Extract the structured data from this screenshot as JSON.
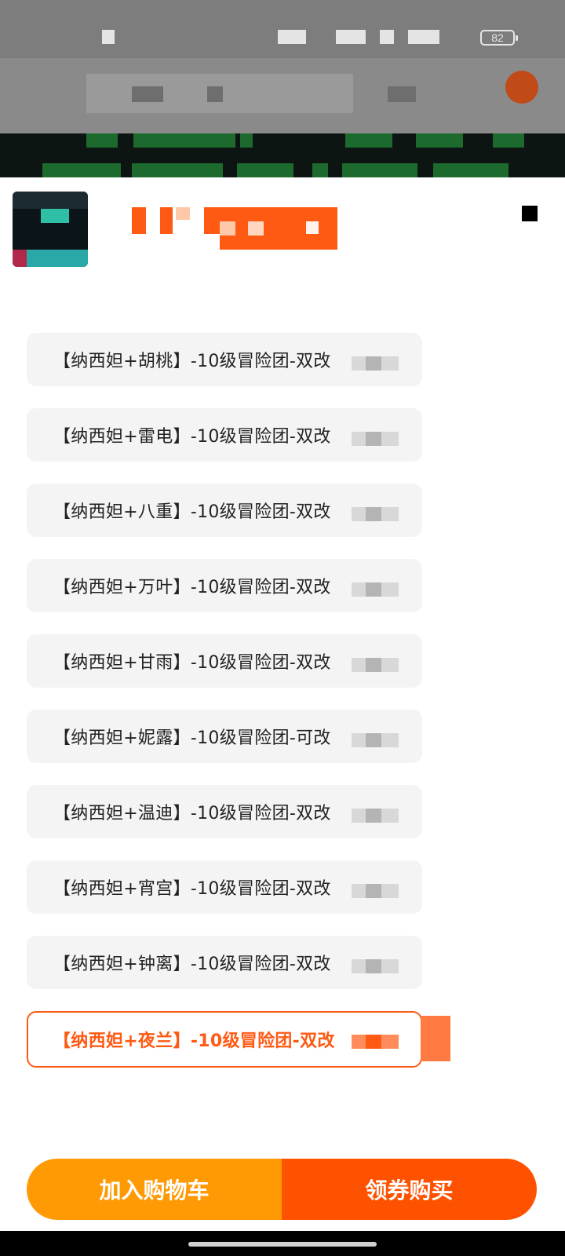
{
  "status_bar": {
    "battery": "82"
  },
  "product": {
    "options": [
      {
        "label": "【纳西妲+胡桃】-10级冒险团-双改",
        "selected": false
      },
      {
        "label": "【纳西妲+雷电】-10级冒险团-双改",
        "selected": false
      },
      {
        "label": "【纳西妲+八重】-10级冒险团-双改",
        "selected": false
      },
      {
        "label": "【纳西妲+万叶】-10级冒险团-双改",
        "selected": false
      },
      {
        "label": "【纳西妲+甘雨】-10级冒险团-双改",
        "selected": false
      },
      {
        "label": "【纳西妲+妮露】-10级冒险团-可改",
        "selected": false
      },
      {
        "label": "【纳西妲+温迪】-10级冒险团-双改",
        "selected": false
      },
      {
        "label": "【纳西妲+宵宫】-10级冒险团-双改",
        "selected": false
      },
      {
        "label": "【纳西妲+钟离】-10级冒险团-双改",
        "selected": false
      },
      {
        "label": "【纳西妲+夜兰】-10级冒险团-双改",
        "selected": true
      }
    ]
  },
  "buttons": {
    "add_to_cart": "加入购物车",
    "buy_with_coupon": "领券购买"
  },
  "colors": {
    "accent": "#ff5a14",
    "cart_button": "#ff9a05",
    "buy_button": "#ff5200"
  }
}
